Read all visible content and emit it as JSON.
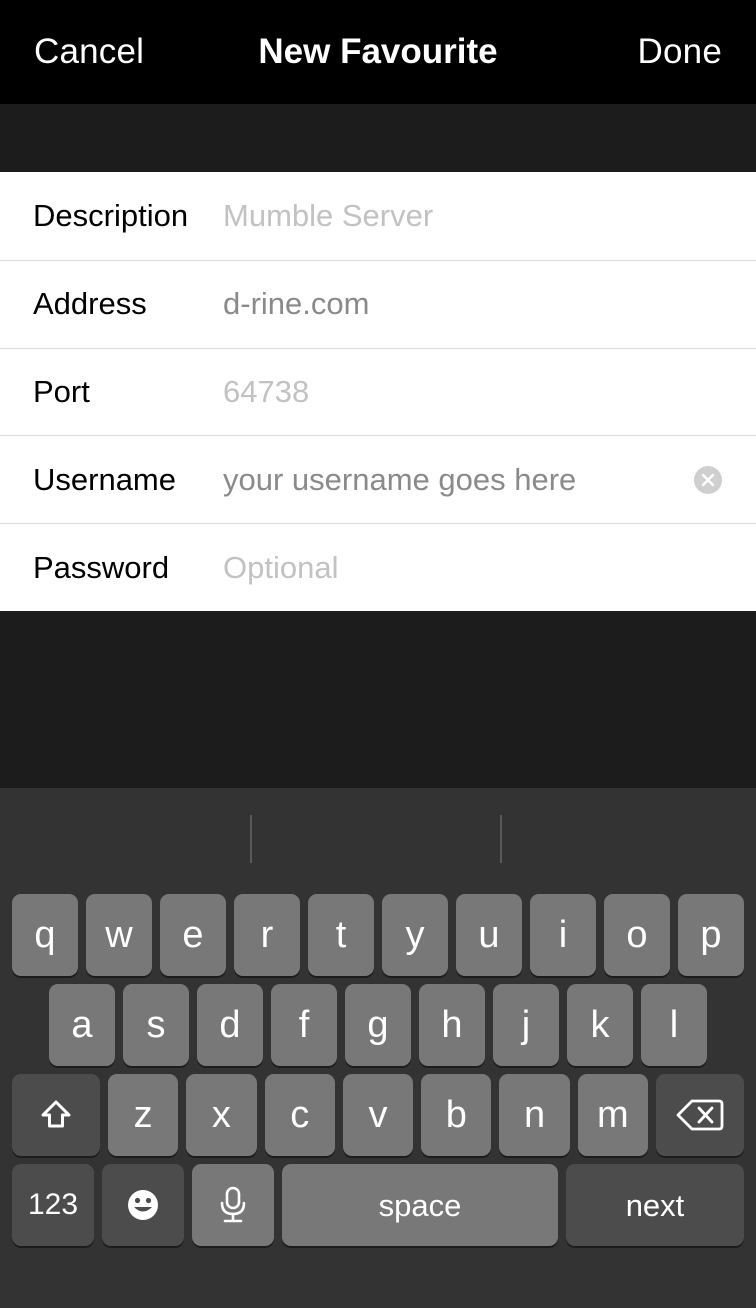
{
  "navbar": {
    "cancel_label": "Cancel",
    "title": "New Favourite",
    "done_label": "Done"
  },
  "form": {
    "rows": [
      {
        "label": "Description",
        "value": "Mumble Server",
        "state": "placeholder",
        "has_clear": false
      },
      {
        "label": "Address",
        "value": "d-rine.com",
        "state": "filled",
        "has_clear": false
      },
      {
        "label": "Port",
        "value": "64738",
        "state": "placeholder",
        "has_clear": false
      },
      {
        "label": "Username",
        "value": "your username goes here",
        "state": "filled",
        "has_clear": true
      },
      {
        "label": "Password",
        "value": "Optional",
        "state": "placeholder",
        "has_clear": false
      }
    ]
  },
  "keyboard": {
    "row1": [
      "q",
      "w",
      "e",
      "r",
      "t",
      "y",
      "u",
      "i",
      "o",
      "p"
    ],
    "row2": [
      "a",
      "s",
      "d",
      "f",
      "g",
      "h",
      "j",
      "k",
      "l"
    ],
    "row3_letters": [
      "z",
      "x",
      "c",
      "v",
      "b",
      "n",
      "m"
    ],
    "shift_icon": "shift-up-arrow-icon",
    "backspace_icon": "backspace-delete-icon",
    "numbers_label": "123",
    "emoji_icon": "emoji-smiley-icon",
    "dictation_icon": "microphone-icon",
    "space_label": "space",
    "return_label": "next"
  },
  "colors": {
    "navbar_bg": "#000000",
    "gap_bg": "#1c1c1c",
    "form_bg": "#ffffff",
    "separator": "#dcdcdc",
    "label_text": "#000000",
    "placeholder_text": "#c2c2c2",
    "value_text": "#8a8a8a",
    "keyboard_bg": "#333333",
    "key_light": "#787878",
    "key_dark": "#4c4c4c",
    "key_text": "#ffffff",
    "clear_button": "#cfcfcf"
  }
}
